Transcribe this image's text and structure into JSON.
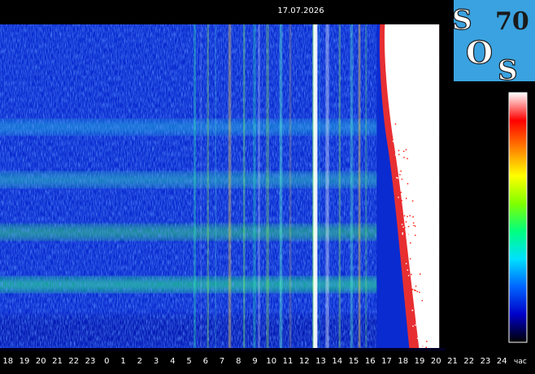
{
  "chart_data": {
    "type": "heatmap",
    "title": "17.07.2026",
    "x_unit": "час",
    "x_ticks": [
      "17",
      "18",
      "19",
      "20",
      "21",
      "22",
      "23",
      "0",
      "1",
      "2",
      "3",
      "4",
      "5",
      "6",
      "7",
      "8",
      "9",
      "10",
      "11",
      "12",
      "13",
      "14",
      "15",
      "16",
      "17",
      "18",
      "19",
      "20",
      "21",
      "22",
      "23",
      "24"
    ],
    "y_range_hz": [
      0,
      40
    ],
    "harmonics_hz": [
      7.83,
      14.3,
      20.8,
      27.3
    ],
    "data_end_hour": 20.2,
    "saturation_start_hour": 16.4,
    "colorscale": [
      "#000000",
      "#0000c8",
      "#0064ff",
      "#00e0ff",
      "#00ff80",
      "#80ff00",
      "#ffff00",
      "#ff8000",
      "#ff0000",
      "#ffffff"
    ],
    "colorbar_range": [
      0,
      1
    ],
    "colors": {
      "background": "#000000",
      "base_spectrogram": "#0a2bd0",
      "band_green": "#2de36a",
      "saturation": "#ffffff",
      "logo_box": "#3aa2e0"
    }
  },
  "logo": {
    "letter_top": "S",
    "letter_mid": "O",
    "letter_bottom": "S",
    "number": "70"
  }
}
